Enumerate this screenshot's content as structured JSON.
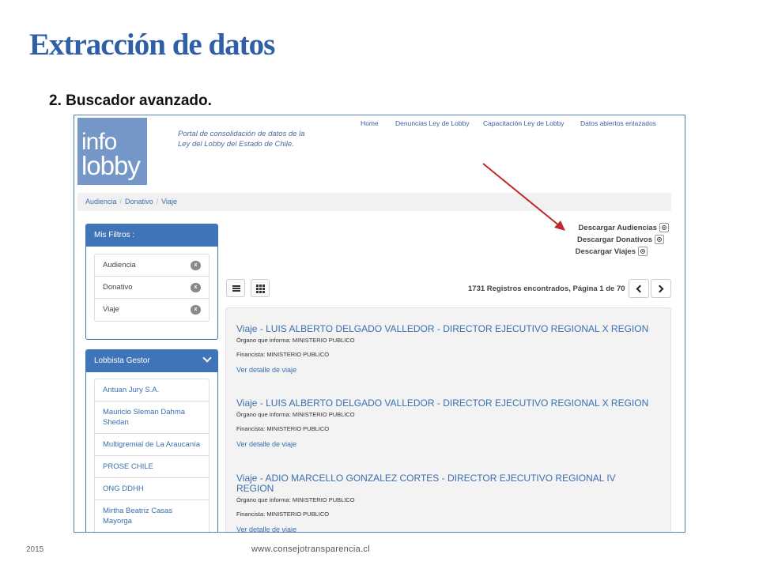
{
  "slide": {
    "title": "Extracción de datos",
    "subtitle": "2. Buscador avanzado.",
    "footer_year": "2015",
    "footer_url": "www.consejotransparencia.cl"
  },
  "site": {
    "logo_line1": "info",
    "logo_line2": "lobby",
    "tagline_line1": "Portal de consolidación de datos de la",
    "tagline_line2": "Ley del Lobby del Estado de Chile.",
    "nav": [
      "Home",
      "Denuncias Ley de Lobby",
      "Capacitación Ley de Lobby",
      "Datos abiertos enlazados"
    ]
  },
  "breadcrumb": [
    "Audiencia",
    "Donativo",
    "Viaje"
  ],
  "filters_panel": {
    "title": "Mis Filtros :",
    "items": [
      "Audiencia",
      "Donativo",
      "Viaje"
    ],
    "remove_glyph": "x"
  },
  "lobbista_panel": {
    "title": "Lobbista Gestor",
    "items": [
      "Antuan Jury S.A.",
      "Mauricio Sleman Dahma Shedan",
      "Multigremial de La Araucanía",
      "PROSE CHILE",
      "ONG DDHH",
      "Mirtha Beatriz Casas Mayorga"
    ]
  },
  "downloads": [
    "Descargar Audiencias",
    "Descargar Donativos",
    "Descargar Viajes"
  ],
  "records_text": "1731 Registros encontrados, Página 1 de 70",
  "results": [
    {
      "title": "Viaje - LUIS ALBERTO DELGADO VALLEDOR - DIRECTOR EJECUTIVO REGIONAL X REGION",
      "organo": "Órgano que informa: MINISTERIO PUBLICO",
      "financista": "Financista: MINISTERIO PUBLICO",
      "link": "Ver detalle de viaje"
    },
    {
      "title": "Viaje - LUIS ALBERTO DELGADO VALLEDOR - DIRECTOR EJECUTIVO REGIONAL X REGION",
      "organo": "Órgano que informa: MINISTERIO PUBLICO",
      "financista": "Financista: MINISTERIO PUBLICO",
      "link": "Ver detalle de viaje"
    },
    {
      "title": "Viaje - ADIO MARCELLO GONZALEZ CORTES - DIRECTOR EJECUTIVO REGIONAL IV REGION",
      "organo": "Órgano que informa: MINISTERIO PUBLICO",
      "financista": "Financista: MINISTERIO PUBLICO",
      "link": "Ver detalle de viaje"
    }
  ],
  "colors": {
    "title_blue": "#2f5fa8",
    "panel_blue": "#3f74b8",
    "logo_bg": "#7597c8",
    "link_blue": "#3a6fb0",
    "arrow_red": "#c0282d"
  }
}
